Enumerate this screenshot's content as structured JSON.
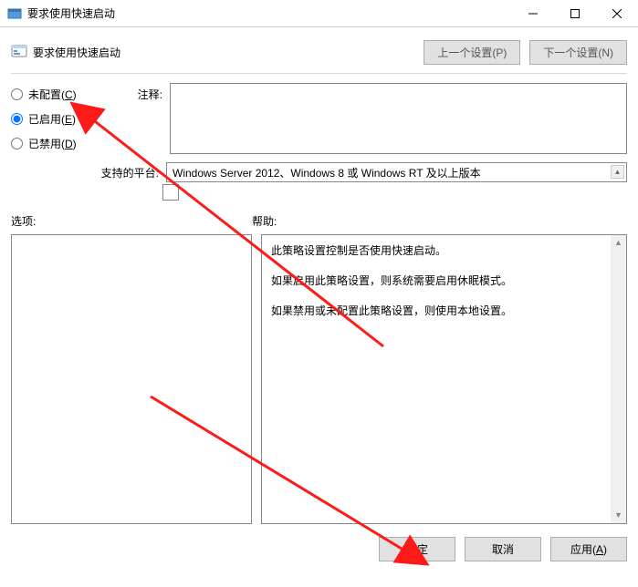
{
  "titlebar": {
    "title": "要求使用快速启动"
  },
  "header": {
    "title": "要求使用快速启动",
    "prev_button": "上一个设置(P)",
    "next_button": "下一个设置(N)"
  },
  "radios": {
    "not_configured": {
      "label_pre": "未配置(",
      "hotkey": "C",
      "label_post": ")"
    },
    "enabled": {
      "label_pre": "已启用(",
      "hotkey": "E",
      "label_post": ")"
    },
    "disabled": {
      "label_pre": "已禁用(",
      "hotkey": "D",
      "label_post": ")"
    },
    "selected": "enabled"
  },
  "labels": {
    "comment": "注释:",
    "supported": "支持的平台:",
    "options": "选项:",
    "help": "帮助:"
  },
  "comment_value": "",
  "supported_platforms": "Windows Server 2012、Windows 8 或 Windows RT 及以上版本",
  "help_text": {
    "p1": "此策略设置控制是否使用快速启动。",
    "p2": "如果启用此策略设置，则系统需要启用休眠模式。",
    "p3": "如果禁用或未配置此策略设置，则使用本地设置。"
  },
  "footer": {
    "ok": "确定",
    "cancel": "取消",
    "apply_pre": "应用(",
    "apply_hotkey": "A",
    "apply_post": ")"
  }
}
